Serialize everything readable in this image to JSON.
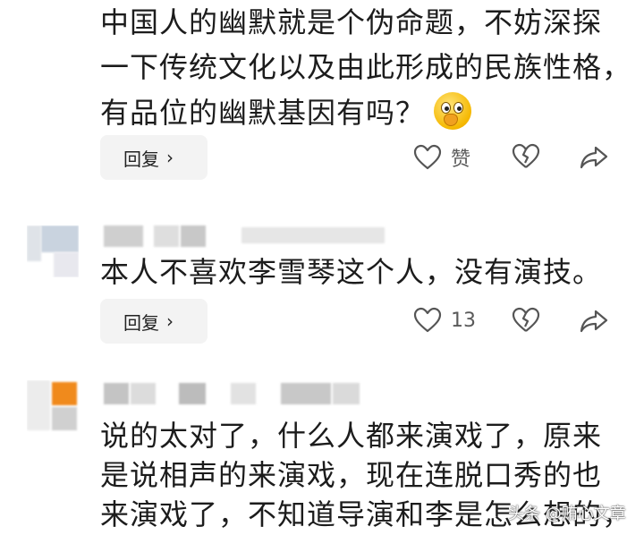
{
  "comments": [
    {
      "lines": [
        "中国人的幽默就是个伪命题，不妨深探",
        "一下传统文化以及由此形成的民族性格，",
        "有品位的幽默基因有吗？"
      ],
      "emoji": "shushing-face-emoji",
      "reply_label": "回复",
      "like_label": "赞"
    },
    {
      "lines": [
        "本人不喜欢李雪琴这个人，没有演技。"
      ],
      "reply_label": "回复",
      "like_count": "13"
    },
    {
      "lines": [
        "说的太对了，什么人都来演戏了，原来",
        "是说相声的来演戏，现在连脱口秀的也",
        "来演戏了，不知道导演和李是怎么想的，"
      ]
    }
  ],
  "icons": {
    "reply_chevron": "chevron-right-icon",
    "like": "heart-outline-icon",
    "dislike": "broken-heart-icon",
    "share": "share-arrow-icon"
  },
  "watermark": "头条 @贿心文章"
}
